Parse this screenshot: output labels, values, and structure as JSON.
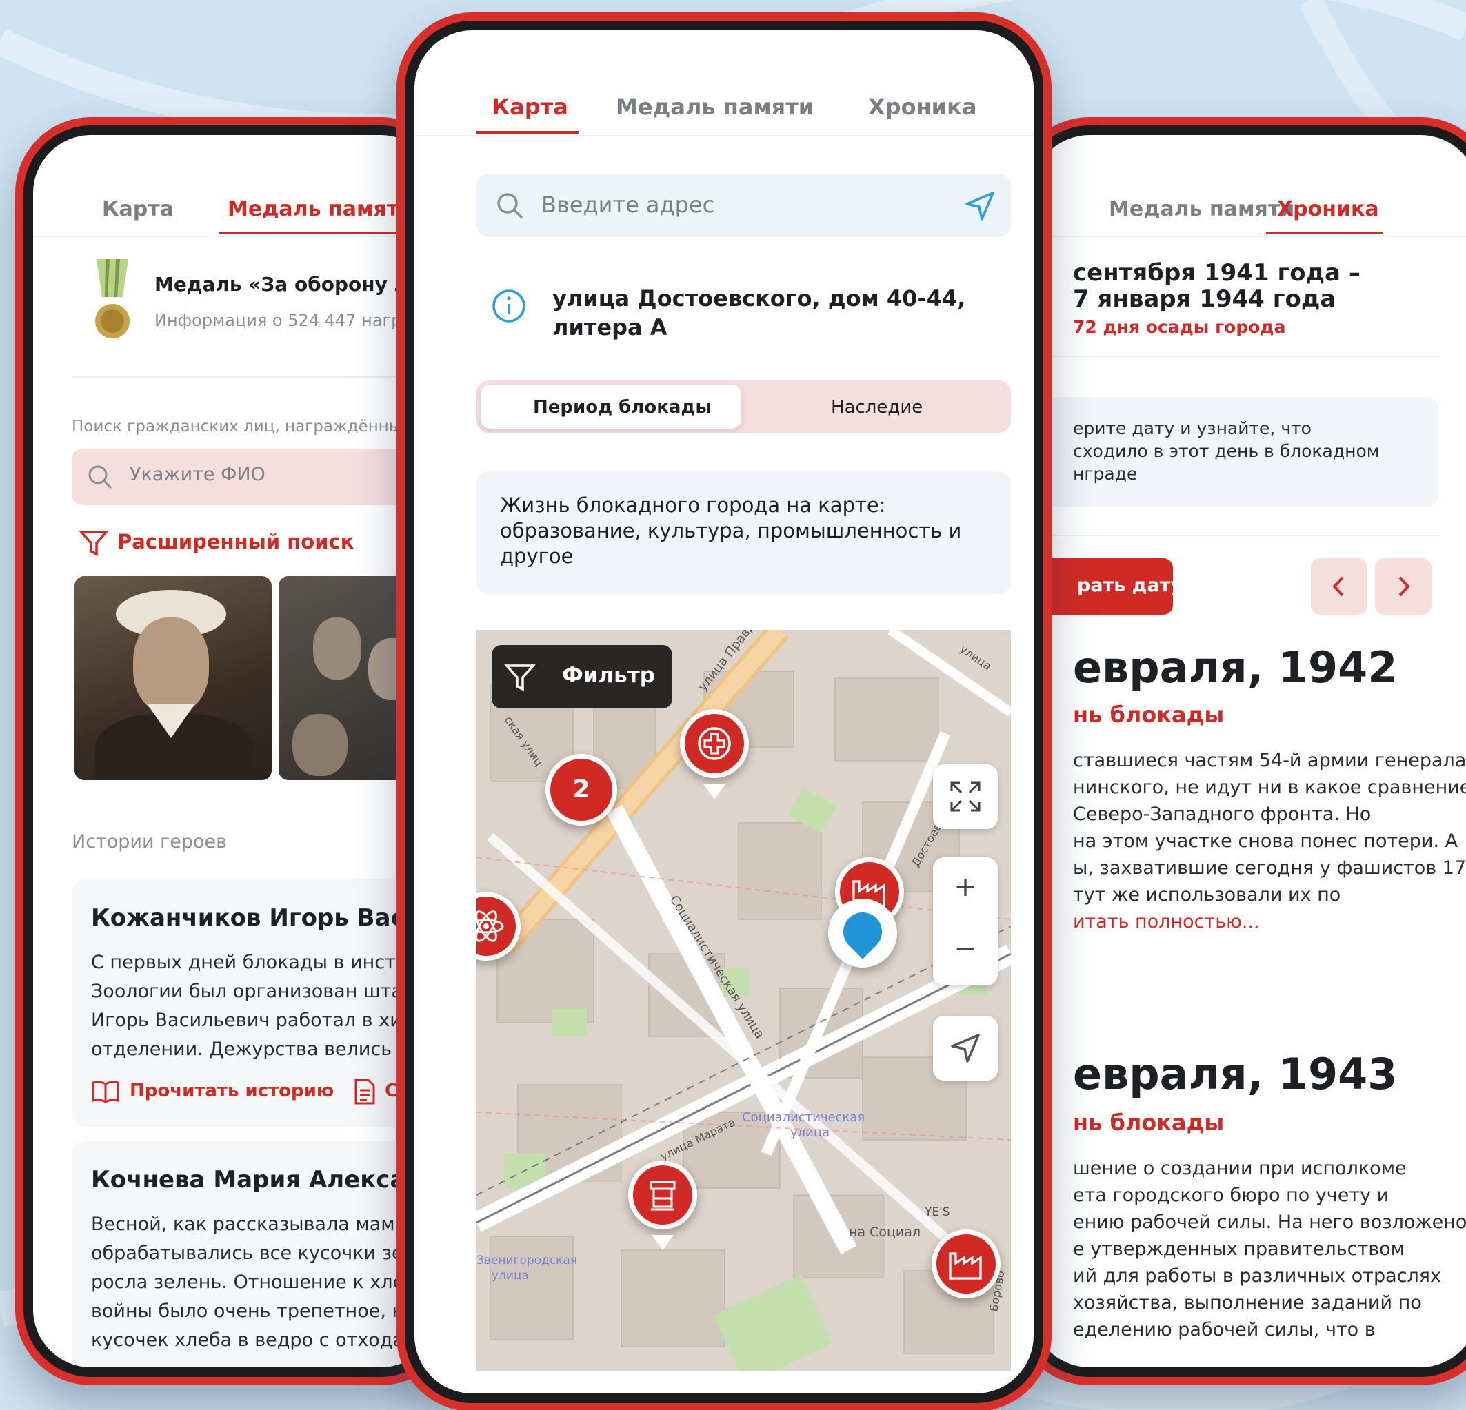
{
  "colors": {
    "accent": "#d12a24",
    "frame": "#d92f2a",
    "background": "#cfe3f2"
  },
  "left": {
    "tabs": [
      {
        "label": "Карта",
        "active": false
      },
      {
        "label": "Медаль памяти",
        "active": true
      }
    ],
    "medal": {
      "title": "Медаль «За оборону Ле",
      "subtitle": "Информация о 524 447 награ",
      "icon": "medal-icon"
    },
    "search_caption": "Поиск гражданских лиц, награждённых",
    "search_placeholder": "Укажите ФИО",
    "advanced_search": "Расширенный поиск",
    "stories_heading": "Истории героев",
    "stories": [
      {
        "name": "Кожанчиков Игорь Васи",
        "lines": [
          "С первых дней блокады в инстит",
          "Зоологии был организован шта",
          "Игорь Васильевич работал в хи",
          "отделении. Дежурства велись к"
        ],
        "read": "Прочитать историю",
        "second_action": "С"
      },
      {
        "name": "Кочнева Мария Алексан",
        "lines": [
          "Весной, как рассказывала мама,",
          "обрабатывались все кусочки зе",
          "росла зелень. Отношение к хле",
          "войны было очень трепетное, н",
          "кусочек хлеба в ведро с отходам"
        ]
      }
    ]
  },
  "center": {
    "tabs": [
      {
        "label": "Карта",
        "active": true
      },
      {
        "label": "Медаль памяти",
        "active": false
      },
      {
        "label": "Хроника",
        "active": false
      }
    ],
    "search_placeholder": "Введите адрес",
    "address": [
      "улица Достоевского, дом 40-44,",
      "литера А"
    ],
    "segments": [
      {
        "label": "Период блокады",
        "active": true
      },
      {
        "label": "Наследие",
        "active": false
      }
    ],
    "info_lines": [
      "Жизнь блокадного города на карте:",
      "образование, культура, промышленность и",
      "другое"
    ],
    "map": {
      "filter_label": "Фильтр",
      "cluster_count": "2",
      "street_labels": [
        "улица Правды",
        "Социалистическая улица",
        "Социалистическая",
        "улица",
        "улица Марата",
        "Достоевс",
        "на Социал",
        "YE'S",
        "Звенигородская",
        "улица",
        "ская улиц",
        "Борово",
        "улица"
      ],
      "zoom_in": "+",
      "zoom_out": "−"
    }
  },
  "right": {
    "tabs": [
      {
        "label": "Медаль памяти",
        "active": false
      },
      {
        "label": "Хроника",
        "active": true
      }
    ],
    "period_lines": [
      "сентября 1941 года –",
      "7 января 1944 года"
    ],
    "period_days": "72 дня осады города",
    "hint_lines": [
      "ерите дату и узнайте, что",
      "сходило в этот день в блокадном",
      "нграде"
    ],
    "choose_date": "рать дату",
    "entries": [
      {
        "date": "евраля, 1942",
        "day": "нь блокады",
        "lines": [
          "ставшиеся частям 54-й армии генерала",
          "нинского, не идут ни в какое сравнение",
          "Северо-Западного фронта. Но",
          "на этом участке снова понес потери. А",
          "ы, захватившие сегодня у фашистов 17",
          "тут же использовали их по"
        ],
        "more": "итать полностью..."
      },
      {
        "date": "евраля, 1943",
        "day": "нь блокады",
        "lines": [
          "шение о создании при исполкоме",
          "ета городского бюро по учету и",
          "ению рабочей силы. На него возложено",
          "е утвержденных правительством",
          "ий для работы в различных отраслях",
          "хозяйства, выполнение заданий по",
          "еделению рабочей силы, что в"
        ]
      }
    ]
  }
}
